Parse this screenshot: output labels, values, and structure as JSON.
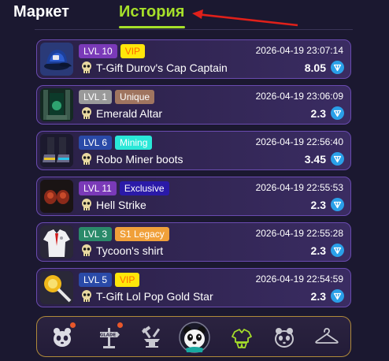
{
  "tabs": {
    "market": "Маркет",
    "history": "История"
  },
  "colors": {
    "accent": "#a6df2a",
    "ton": "#2aa0e8",
    "annotation": "#e0201a"
  },
  "items": [
    {
      "level": "LVL 10",
      "level_color": "#7a3ab8",
      "tag": "VIP",
      "tag_color": "#ffe60a",
      "tag_text_color": "#ff6a00",
      "date": "2026-04-19 23:07:14",
      "name": "T-Gift Durov's Cap Captain",
      "price": "8.05",
      "thumb": "cap-icon"
    },
    {
      "level": "LVL 1",
      "level_color": "#9a9a9a",
      "tag": "Unique",
      "tag_color": "#a07560",
      "tag_text_color": "#ffffff",
      "date": "2026-04-19 23:06:09",
      "name": "Emerald Altar",
      "price": "2.3",
      "thumb": "altar-icon"
    },
    {
      "level": "LVL 6",
      "level_color": "#2a4aa8",
      "tag": "Mining",
      "tag_color": "#2ae8d8",
      "tag_text_color": "#ffffff",
      "date": "2026-04-19 22:56:40",
      "name": "Robo Miner boots",
      "price": "3.45",
      "thumb": "boots-icon"
    },
    {
      "level": "LVL 11",
      "level_color": "#7a3ab8",
      "tag": "Exclusive",
      "tag_color": "#2a1aa8",
      "tag_text_color": "#ffffff",
      "date": "2026-04-19 22:55:53",
      "name": "Hell Strike",
      "price": "2.3",
      "thumb": "gloves-icon"
    },
    {
      "level": "LVL 3",
      "level_color": "#2a8a6a",
      "tag": "S1 Legacy",
      "tag_color": "#f0a03a",
      "tag_text_color": "#ffffff",
      "date": "2026-04-19 22:55:28",
      "name": "Tycoon's shirt",
      "price": "2.3",
      "thumb": "shirt-icon"
    },
    {
      "level": "LVL 5",
      "level_color": "#2a4aa8",
      "tag": "VIP",
      "tag_color": "#ffe60a",
      "tag_text_color": "#ff6a00",
      "date": "2026-04-19 22:54:59",
      "name": "T-Gift Lol Pop Gold Star",
      "price": "2.3",
      "thumb": "lollipop-icon"
    }
  ],
  "bottom_nav": [
    {
      "icon": "panda-face-icon",
      "badge": true
    },
    {
      "icon": "signpost-icon",
      "sign_text": "GLADE",
      "badge": true
    },
    {
      "icon": "anvil-hammer-icon",
      "badge": false
    },
    {
      "icon": "panda-avatar-icon",
      "badge": false
    },
    {
      "icon": "outfit-icon",
      "badge": false
    },
    {
      "icon": "panda-outline-icon",
      "badge": false
    },
    {
      "icon": "hanger-icon",
      "badge": false
    }
  ]
}
